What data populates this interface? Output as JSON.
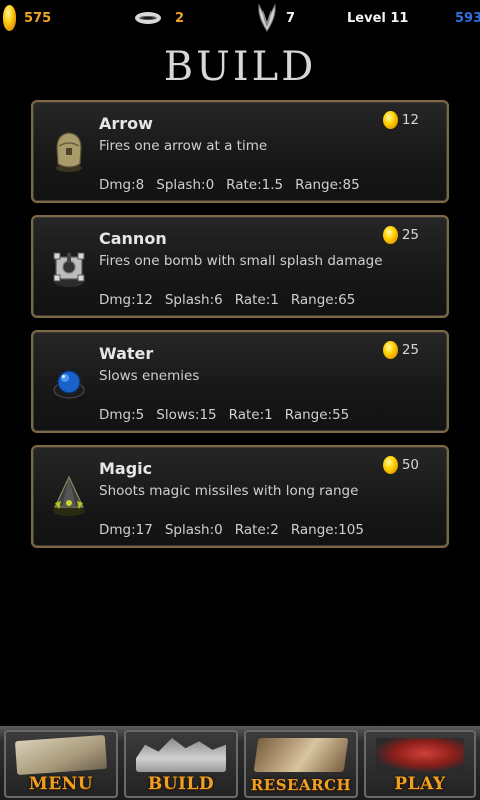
{
  "status": {
    "gold": "575",
    "halos": "2",
    "wings": "7",
    "level": "Level 11",
    "score": "593"
  },
  "title": "BUILD",
  "towers": [
    {
      "name": "Arrow",
      "cost": "12",
      "desc": "Fires one arrow at a time",
      "stats": [
        "Dmg:8",
        "Splash:0",
        "Rate:1.5",
        "Range:85"
      ],
      "icon": "arrow-tower-icon"
    },
    {
      "name": "Cannon",
      "cost": "25",
      "desc": "Fires one bomb with small splash damage",
      "stats": [
        "Dmg:12",
        "Splash:6",
        "Rate:1",
        "Range:65"
      ],
      "icon": "cannon-tower-icon"
    },
    {
      "name": "Water",
      "cost": "25",
      "desc": "Slows enemies",
      "stats": [
        "Dmg:5",
        "Slows:15",
        "Rate:1",
        "Range:55"
      ],
      "icon": "water-tower-icon"
    },
    {
      "name": "Magic",
      "cost": "50",
      "desc": "Shoots magic missiles with long range",
      "stats": [
        "Dmg:17",
        "Splash:0",
        "Rate:2",
        "Range:105"
      ],
      "icon": "magic-tower-icon"
    }
  ],
  "nav": {
    "menu": "MENU",
    "build": "BUILD",
    "research": "RESEARCH",
    "play": "PLAY"
  },
  "colors": {
    "gold_text": "#f0a623",
    "score_text": "#2f6fe0",
    "card_border": "#7d6a45",
    "nav_label": "#f0a020"
  }
}
